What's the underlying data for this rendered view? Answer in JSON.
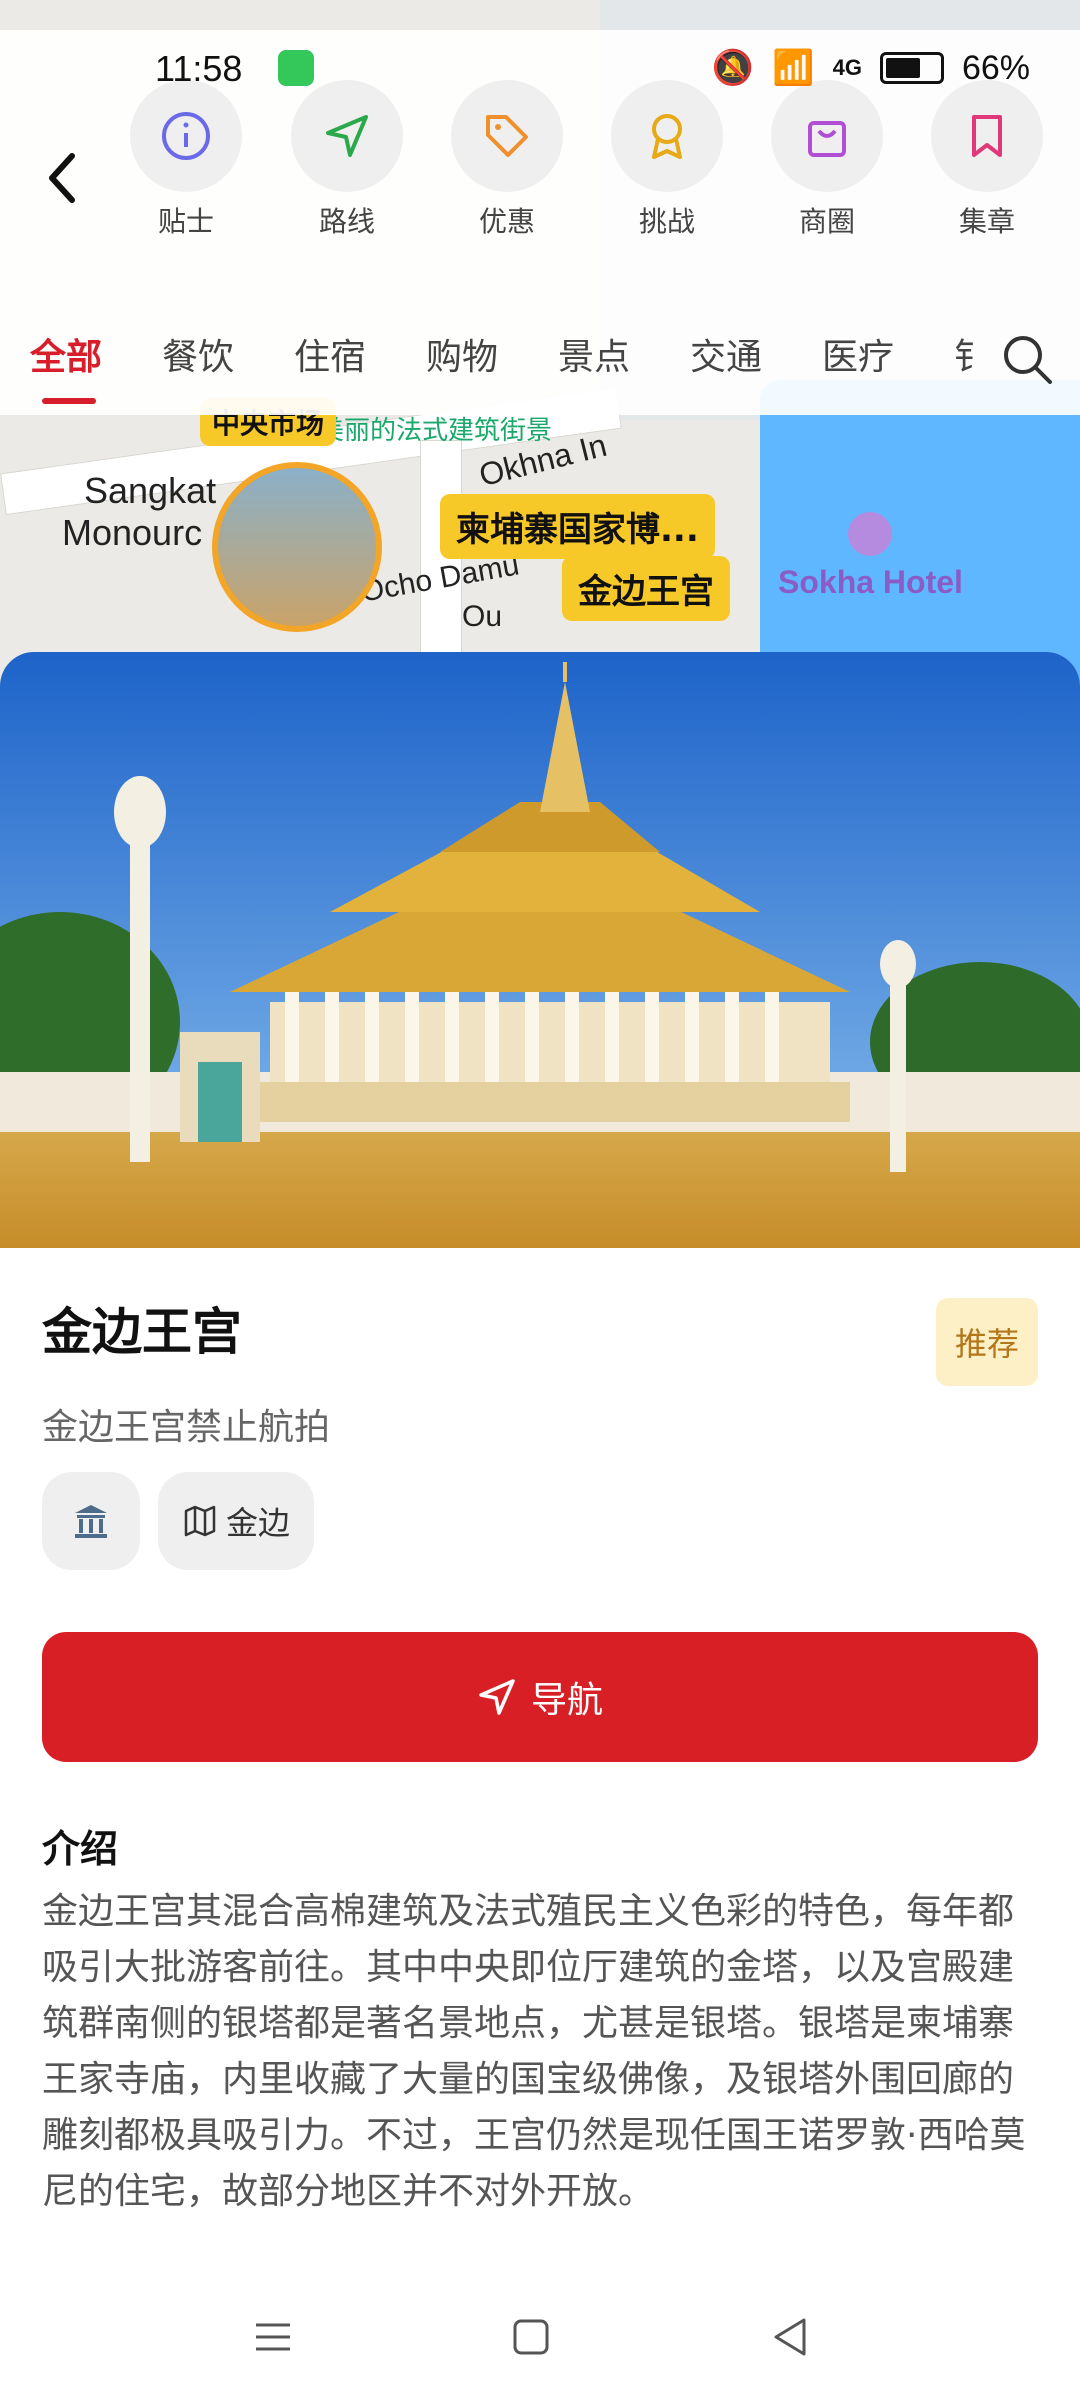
{
  "status_bar": {
    "time": "11:58",
    "battery": "66%",
    "network": "4G"
  },
  "toolbar": {
    "items": [
      {
        "label": "贴士",
        "icon": "info-icon",
        "color": "#6a6ae8"
      },
      {
        "label": "路线",
        "icon": "navigation-icon",
        "color": "#2aa84a"
      },
      {
        "label": "优惠",
        "icon": "tag-icon",
        "color": "#f0902d"
      },
      {
        "label": "挑战",
        "icon": "award-icon",
        "color": "#e8a917"
      },
      {
        "label": "商圈",
        "icon": "shopping-bag-icon",
        "color": "#b04fd6"
      },
      {
        "label": "集章",
        "icon": "bookmark-icon",
        "color": "#e0397a"
      }
    ]
  },
  "tabs": {
    "items": [
      "全部",
      "餐饮",
      "住宿",
      "购物",
      "景点",
      "交通",
      "医疗",
      "钅"
    ],
    "active": "全部"
  },
  "map": {
    "labels": {
      "sangkat": "Sangkat",
      "monourc": "Monourc",
      "okhna": "Okhna In",
      "ocho": "Ocho Damu",
      "ou": "Ou",
      "hotel": "Sokha Hotel",
      "street": "美丽的法式建筑街景"
    },
    "tags": [
      "中央市场",
      "柬埔寨国家博...",
      "金边王宫"
    ]
  },
  "place": {
    "title": "金边王宫",
    "badge": "推荐",
    "subtitle": "金边王宫禁止航拍",
    "chips": [
      {
        "icon": "museum-icon",
        "label": ""
      },
      {
        "icon": "map-icon",
        "label": "金边"
      }
    ],
    "nav_label": "导航",
    "intro_heading": "介绍",
    "intro_text": "金边王宫其混合高棉建筑及法式殖民主义色彩的特色，每年都吸引大批游客前往。其中中央即位厅建筑的金塔，以及宫殿建筑群南侧的银塔都是著名景地点，尤甚是银塔。银塔是柬埔寨王家寺庙，内里收藏了大量的国宝级佛像，及银塔外围回廊的雕刻都极具吸引力。不过，王宫仍然是现任国王诺罗敦·西哈莫尼的住宅，故部分地区并不对外开放。"
  },
  "colors": {
    "accent": "#d91f26",
    "badge_bg": "#fdf0c6",
    "badge_text": "#b3761b"
  }
}
